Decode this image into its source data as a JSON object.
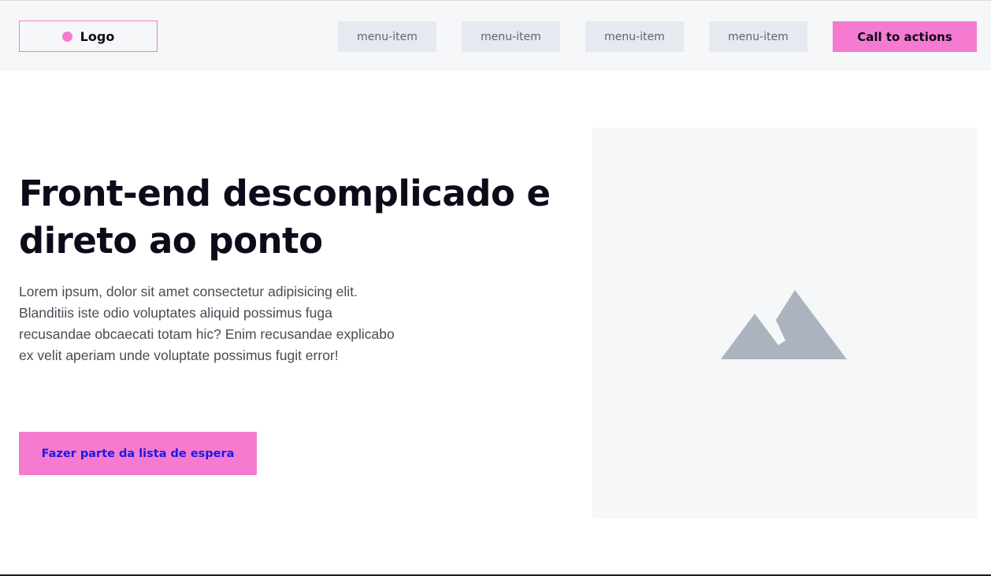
{
  "header": {
    "logo_text": "Logo",
    "menu": [
      "menu-item",
      "menu-item",
      "menu-item",
      "menu-item"
    ],
    "cta_label": "Call to actions"
  },
  "hero": {
    "title": "Front-end descomplicado e direto ao ponto",
    "description": "Lorem ipsum, dolor sit amet consectetur adipisicing elit. Blanditiis iste odio voluptates aliquid possimus fuga recusandae obcaecati totam hic? Enim recusandae explicabo ex velit aperiam unde voluptate possimus fugit error!",
    "button_label": "Fazer parte da lista de espera",
    "image_icon": "image-placeholder-icon"
  },
  "colors": {
    "accent": "#f47bd0",
    "header_bg": "#f6f7f9",
    "menu_bg": "#e6e9ef",
    "button_text": "#1a1ae6",
    "placeholder_icon": "#abb3be"
  }
}
